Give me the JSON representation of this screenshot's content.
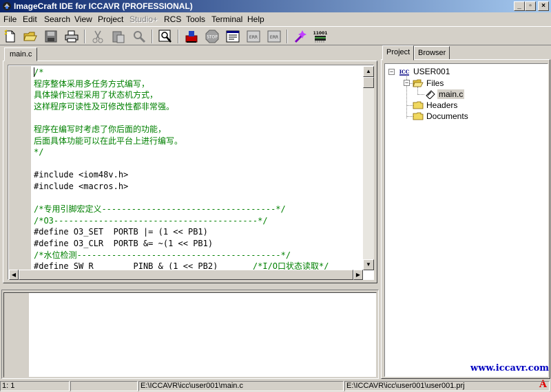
{
  "window": {
    "title": "ImageCraft IDE for ICCAVR (PROFESSIONAL)",
    "min_label": "_",
    "max_label": "▫",
    "close_label": "×"
  },
  "menu": [
    {
      "label": "File"
    },
    {
      "label": "Edit"
    },
    {
      "label": "Search"
    },
    {
      "label": "View"
    },
    {
      "label": "Project"
    },
    {
      "label": "Studio+"
    },
    {
      "label": "RCS"
    },
    {
      "label": "Tools"
    },
    {
      "label": "Terminal"
    },
    {
      "label": "Help"
    }
  ],
  "toolbar": {
    "icons": [
      "new-file-icon",
      "open-folder-icon",
      "save-icon",
      "print-icon",
      "cut-icon",
      "paste-icon",
      "find-replace-icon",
      "find-in-files-icon",
      "build-icon",
      "stop-icon",
      "config-icon",
      "error-list-icon",
      "error-next-icon",
      "magic-wand-icon",
      "chip-programmer-icon"
    ],
    "stop_text": "STOP",
    "err_text": "ERR",
    "chip_text": "11001"
  },
  "editor": {
    "tab_label": "main.c",
    "lines": [
      {
        "text": "/*",
        "kind": "comment"
      },
      {
        "text": "程序整体采用多任务方式编写，",
        "kind": "comment"
      },
      {
        "text": "具体操作过程采用了状态机方式，",
        "kind": "comment"
      },
      {
        "text": "这样程序可读性及可修改性都非常强。",
        "kind": "comment"
      },
      {
        "text": "",
        "kind": "comment"
      },
      {
        "text": "程序在编写时考虑了你后面的功能，",
        "kind": "comment"
      },
      {
        "text": "后面具体功能可以在此平台上进行编写。",
        "kind": "comment"
      },
      {
        "text": "*/",
        "kind": "comment"
      },
      {
        "text": "",
        "kind": "code"
      },
      {
        "text": "#include <iom48v.h>",
        "kind": "code"
      },
      {
        "text": "#include <macros.h>",
        "kind": "code"
      },
      {
        "text": "",
        "kind": "code"
      },
      {
        "text": "/*专用引脚宏定义-----------------------------------*/",
        "kind": "comment"
      },
      {
        "text": "/*O3-----------------------------------------*/",
        "kind": "comment"
      },
      {
        "text": "#define O3_SET  PORTB |= (1 << PB1)",
        "kind": "code"
      },
      {
        "text": "#define O3_CLR  PORTB &= ~(1 << PB1)",
        "kind": "code"
      },
      {
        "text": "/*水位检测-----------------------------------------*/",
        "kind": "comment"
      },
      {
        "text": "#define SW_R        PINB & (1 << PB2)       /*I/O口状态读取*/",
        "kind": "mixed",
        "code": "#define SW_R        PINB & (1 << PB2)       ",
        "comment": "/*I/O口状态读取*/"
      }
    ]
  },
  "project": {
    "tabs": [
      {
        "label": "Project"
      },
      {
        "label": "Browser"
      }
    ],
    "root": "USER001",
    "root_badge": "ICC",
    "files_folder": "Files",
    "file": "main.c",
    "headers_folder": "Headers",
    "documents_folder": "Documents",
    "watermark": "www.iccavr.com",
    "watermark_mark": "A"
  },
  "status": {
    "position": "1: 1",
    "file_path": "E:\\ICCAVR\\icc\\user001\\main.c",
    "project_path": "E:\\ICCAVR\\icc\\user001\\user001.prj"
  },
  "colors": {
    "comment": "#008000",
    "title_start": "#0a246a",
    "title_end": "#a6caf0",
    "chrome": "#d4d0c8"
  }
}
